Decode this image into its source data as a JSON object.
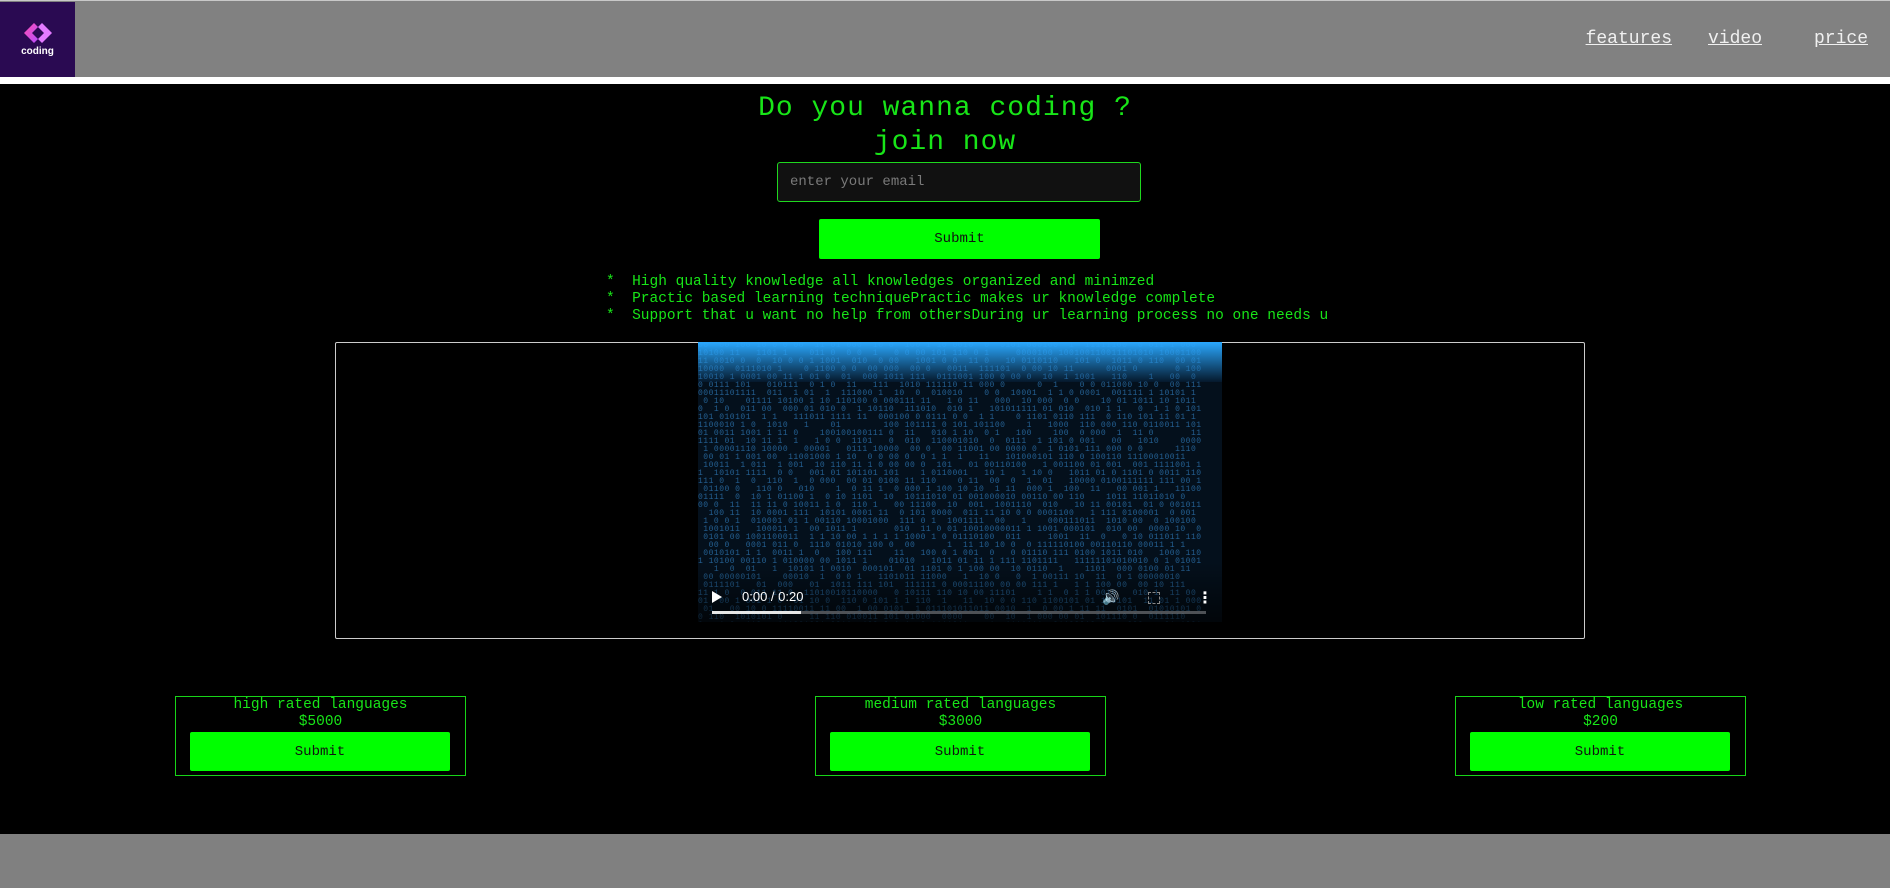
{
  "header": {
    "logo_text": "coding",
    "nav": [
      {
        "label": "features"
      },
      {
        "label": "video"
      },
      {
        "label": "price"
      }
    ]
  },
  "hero": {
    "title_line1": "Do you wanna coding ?",
    "title_line2": "join now",
    "email_placeholder": "enter your email",
    "submit_label": "Submit"
  },
  "features": [
    "*  High quality knowledge all knowledges organized and minimzed",
    "*  Practic based learning techniquePractic makes ur knowledge complete",
    "*  Support that u want no help from othersDuring ur learning process no one needs u"
  ],
  "video": {
    "time": "0:00 / 0:20",
    "progress": 0.18
  },
  "pricing": [
    {
      "title": "high rated languages",
      "price": "$5000",
      "button": "Submit"
    },
    {
      "title": "medium rated languages",
      "price": "$3000",
      "button": "Submit"
    },
    {
      "title": "low rated languages",
      "price": "$200",
      "button": "Submit"
    }
  ],
  "colors": {
    "accent_green": "#00ff00",
    "text_green": "#18e518",
    "header_gray": "#808080",
    "background": "#000000"
  }
}
